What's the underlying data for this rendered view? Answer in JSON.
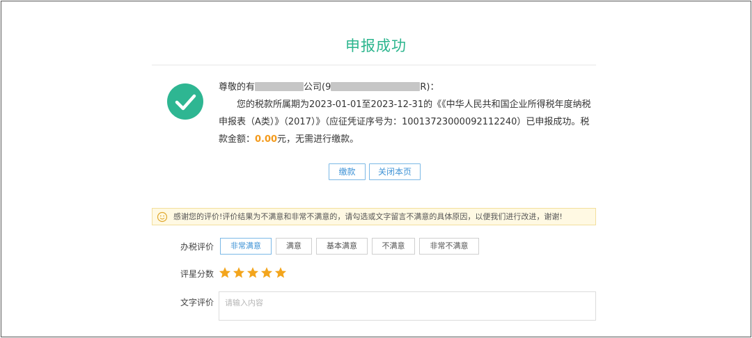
{
  "header": {
    "title": "申报成功"
  },
  "message": {
    "greeting_prefix": "尊敬的",
    "company_partial": "有",
    "company_suffix": "公司",
    "taxid_prefix": "(9",
    "taxid_suffix": "R)：",
    "line_intro": "您的税款所属期为2023-01-01至2023-12-31的《《中华人民共和国企业所得税年度纳税申报表（A类）》（2017）》（应征凭证序号为：10013723000092112240）已申报成功。税款金额：",
    "amount": "0.00",
    "line_tail": "元，无需进行缴款。"
  },
  "actions": {
    "pay_label": "缴款",
    "close_label": "关闭本页"
  },
  "notice": {
    "text": "感谢您的评价!评价结果为不满意和非常不满意的，请勾选或文字留言不满意的具体原因，以便我们进行改进，谢谢!"
  },
  "rating": {
    "label": "办税评价",
    "options": [
      "非常满意",
      "满意",
      "基本满意",
      "不满意",
      "非常不满意"
    ],
    "selected": "非常满意"
  },
  "score": {
    "label": "评星分数",
    "stars": 5,
    "max": 5,
    "star_color": "#f3a51c"
  },
  "comment": {
    "label": "文字评价",
    "placeholder": "请输入内容"
  },
  "colors": {
    "accent": "#2bb58d",
    "link": "#3f93d6",
    "amount": "#f39a1c"
  }
}
